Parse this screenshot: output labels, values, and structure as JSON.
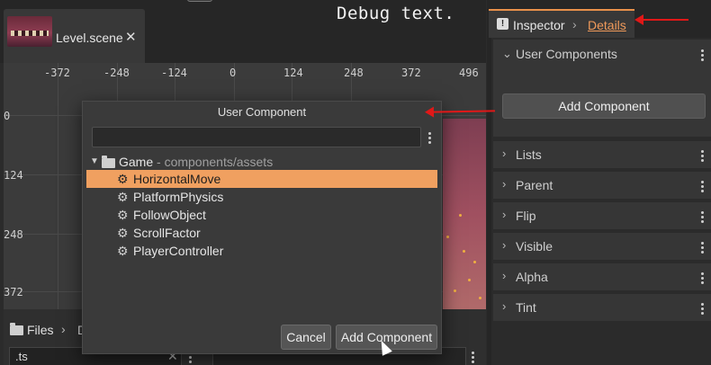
{
  "scene_tab": {
    "title": "Level.scene",
    "close": "✕"
  },
  "viewport": {
    "x_ticks": [
      "-372",
      "-248",
      "-124",
      "0",
      "124",
      "248",
      "372",
      "496"
    ],
    "y_ticks": [
      "0",
      "124",
      "248",
      "372"
    ],
    "debug_text": "Debug text."
  },
  "files": {
    "title": "Files",
    "crumb": "D",
    "filter_value": ".ts",
    "clear": "✕"
  },
  "inspector": {
    "tab_label": "Inspector",
    "details_label": "Details",
    "user_components": {
      "label": "User Components",
      "add_button": "Add Component"
    },
    "sections": [
      "Lists",
      "Parent",
      "Flip",
      "Visible",
      "Alpha",
      "Tint"
    ]
  },
  "modal": {
    "title": "User Component",
    "search_value": "",
    "tree": {
      "root_name": "Game",
      "root_path": "- components/assets",
      "items": [
        "HorizontalMove",
        "PlatformPhysics",
        "FollowObject",
        "ScrollFactor",
        "PlayerController"
      ],
      "selected_index": 0
    },
    "cancel_label": "Cancel",
    "add_label": "Add Component"
  },
  "colors": {
    "accent": "#f0a060",
    "arrow": "#e01818"
  },
  "icons": [
    "folder-icon",
    "gear-icon",
    "info-icon",
    "chevron-right-icon",
    "kebab-menu-icon",
    "close-icon",
    "mouse-cursor-icon"
  ]
}
